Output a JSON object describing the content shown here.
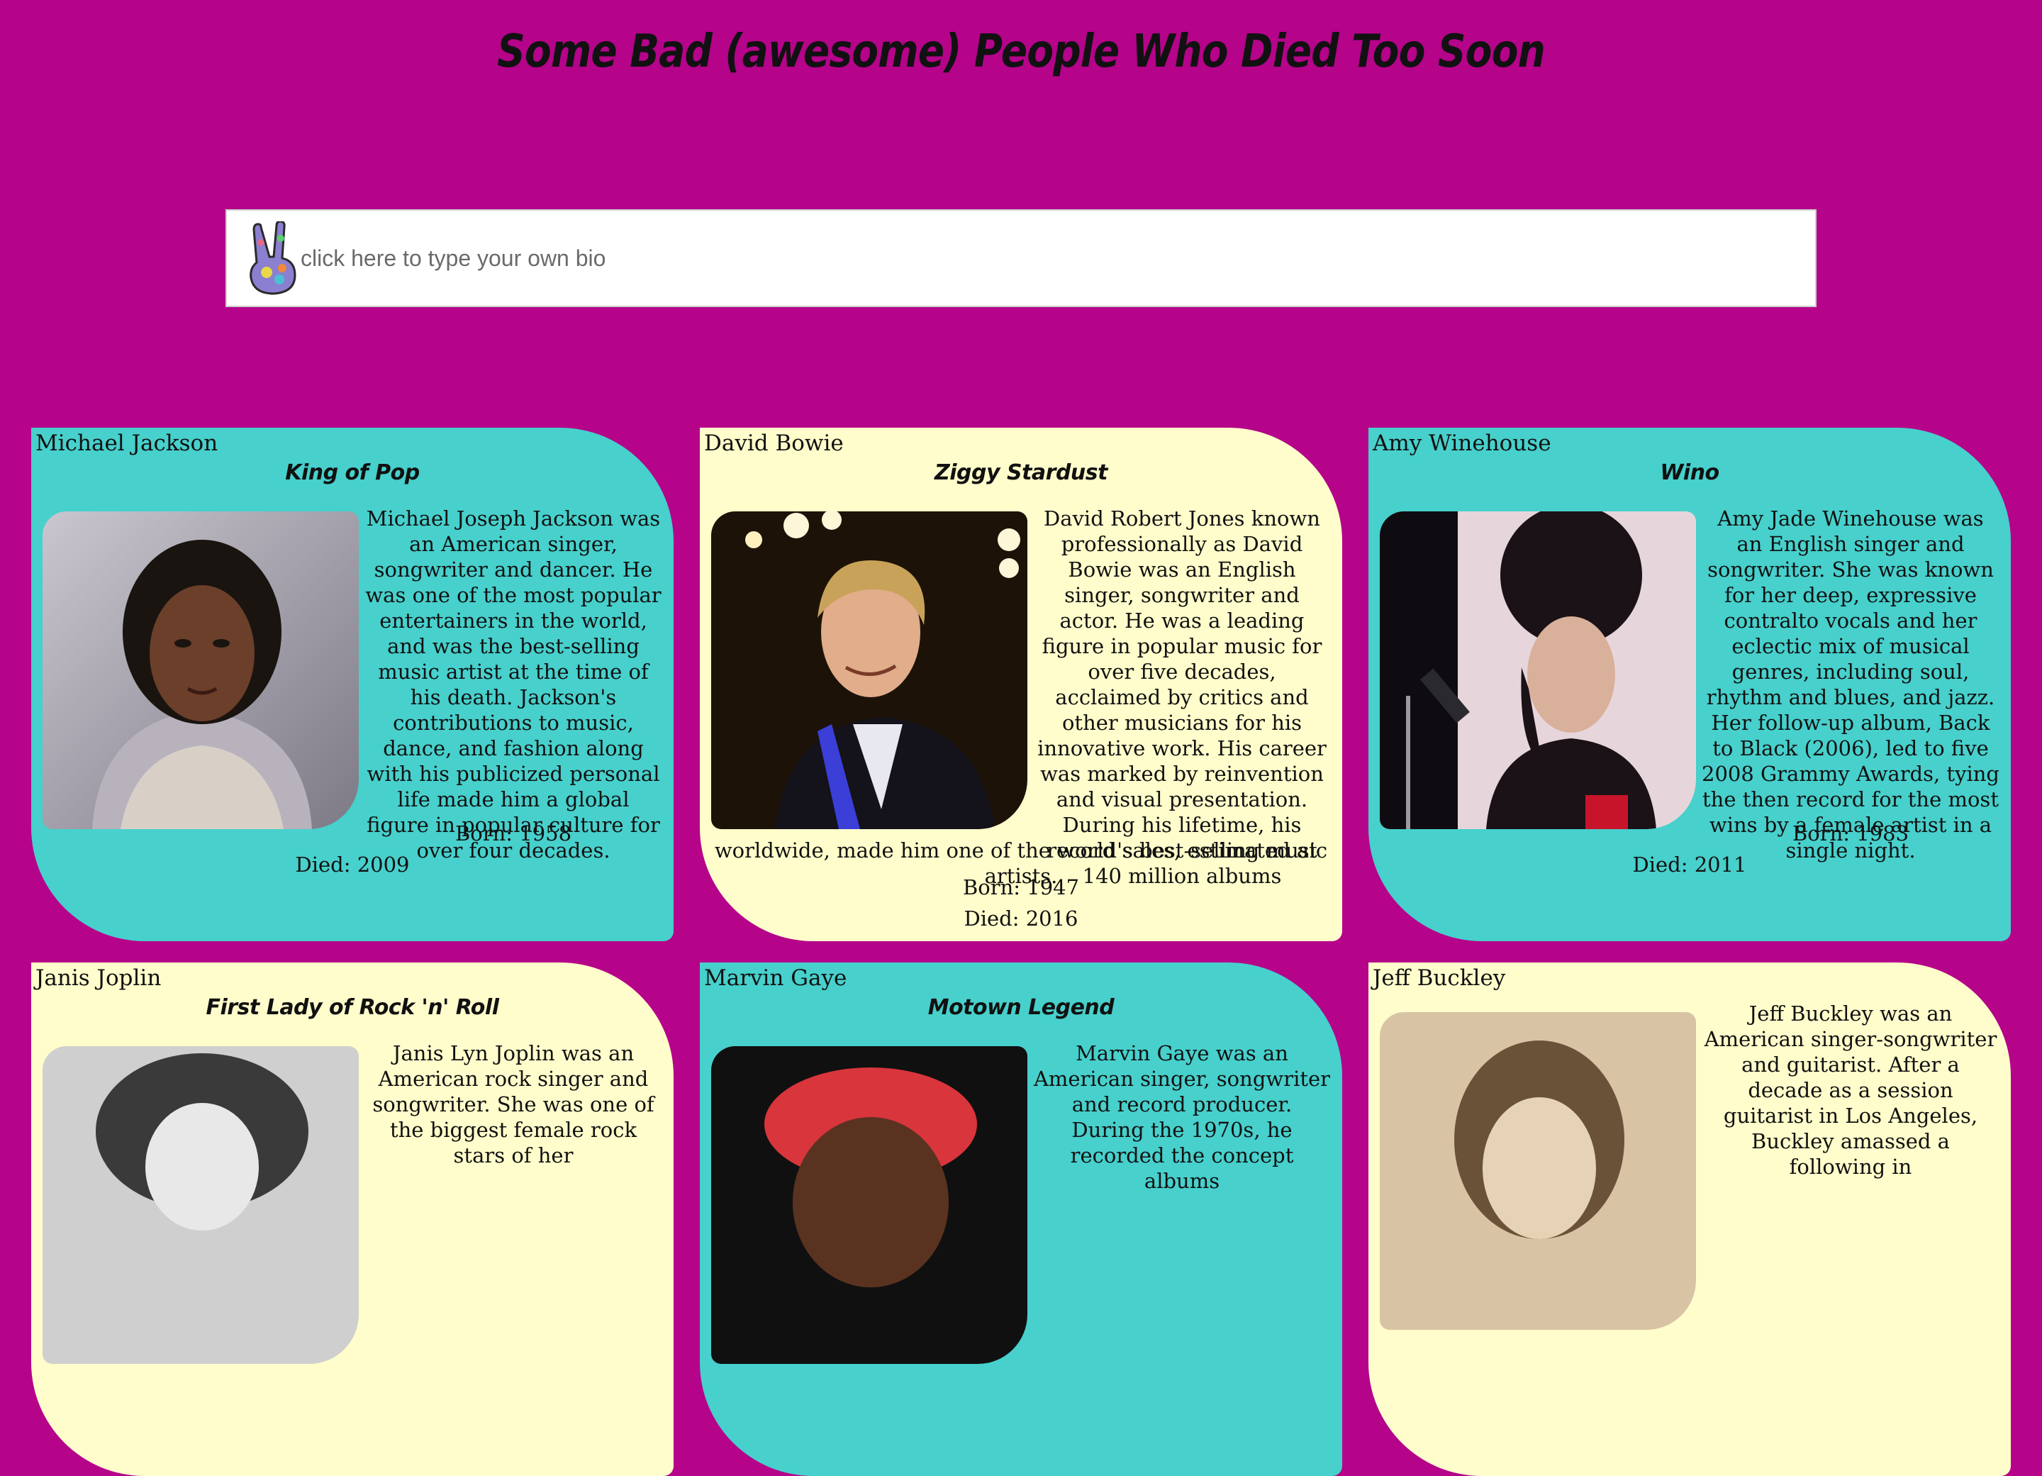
{
  "page": {
    "title": "Some Bad (awesome)  People Who Died Too Soon"
  },
  "bio_input": {
    "placeholder": "click here to type your own bio",
    "icon": "peace-sign-hand-icon"
  },
  "colors": {
    "background": "#b5038a",
    "card_teal": "#47d0cc",
    "card_cream": "#fffdcb"
  },
  "cards": [
    {
      "name": "Michael Jackson",
      "nickname": "King of Pop",
      "bio": "Michael Joseph Jackson was an American singer, songwriter and dancer. He was one of the most popular entertainers in the world, and was the best-selling music artist at the time of his death. Jackson's contributions to music, dance, and fashion along with his publicized personal life made him a global figure in popular culture for over four decades.",
      "born": "Born: 1958",
      "died": "Died: 2009"
    },
    {
      "name": "David Bowie",
      "nickname": "Ziggy Stardust",
      "bio": "David Robert Jones known professionally as David Bowie was an English singer, songwriter and actor. He was a leading figure in popular music for over five decades, acclaimed by critics and other musicians for his innovative work. His career was marked by reinvention and visual presentation. During his lifetime, his record sales, estimated at 140 million albums",
      "bio_tail": "worldwide, made him one of the world's best-selling music artists.",
      "born": "Born: 1947",
      "died": "Died: 2016"
    },
    {
      "name": "Amy Winehouse",
      "nickname": "Wino",
      "bio": "Amy Jade Winehouse was an English singer and songwriter. She was known for her deep, expressive contralto vocals and her eclectic mix of musical genres, including soul, rhythm and blues, and jazz. Her follow-up album, Back to Black (2006), led to five 2008 Grammy Awards, tying the then record for the most wins by a female artist in a single night.",
      "born": "Born: 1983",
      "died": "Died: 2011"
    },
    {
      "name": "Janis Joplin",
      "nickname": "First Lady of Rock 'n' Roll",
      "bio": "Janis Lyn Joplin was an American rock singer and songwriter. She was one of the biggest female rock stars of her"
    },
    {
      "name": "Marvin Gaye",
      "nickname": "Motown Legend",
      "bio": "Marvin Gaye was an American singer, songwriter and record producer. During the 1970s, he recorded the concept albums"
    },
    {
      "name": "Jeff Buckley",
      "nickname": "",
      "bio": "Jeff Buckley was an American singer-songwriter and guitarist. After a decade as a session guitarist in Los Angeles, Buckley amassed a following in"
    }
  ]
}
